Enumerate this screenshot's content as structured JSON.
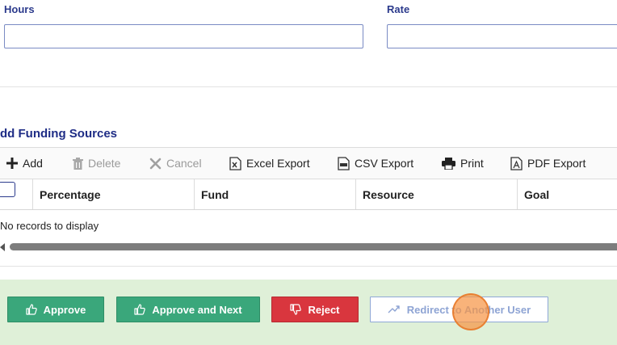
{
  "form": {
    "hours_label": "Hours",
    "hours_value": "",
    "rate_label": "Rate",
    "rate_value": ""
  },
  "funding": {
    "section_title": "dd Funding Sources",
    "toolbar": {
      "add": "Add",
      "delete": "Delete",
      "cancel": "Cancel",
      "excel_export": "Excel Export",
      "csv_export": "CSV Export",
      "print": "Print",
      "pdf_export": "PDF Export"
    },
    "columns": [
      "Percentage",
      "Fund",
      "Resource",
      "Goal"
    ],
    "empty_message": "No records to display"
  },
  "actions": {
    "approve": "Approve",
    "approve_next": "Approve and Next",
    "reject": "Reject",
    "redirect": "Redirect to Another User"
  },
  "colors": {
    "approve": "#3aa77b",
    "reject": "#d9363e",
    "footer_bg": "#dff0d8",
    "title": "#1f2d86"
  }
}
